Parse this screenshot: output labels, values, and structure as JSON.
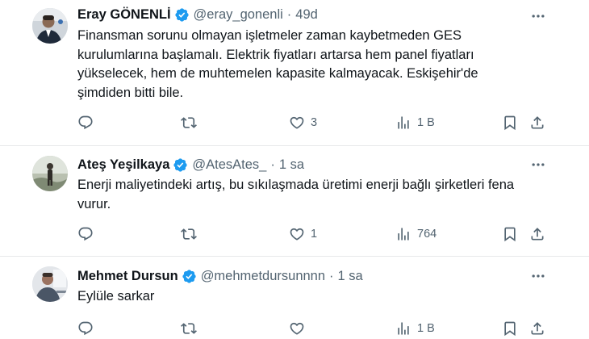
{
  "tweets": [
    {
      "name": "Eray GÖNENLİ",
      "handle": "@eray_gonenli",
      "separator": "·",
      "time": "49d",
      "text": "Finansman sorunu olmayan işletmeler zaman kaybetmeden GES\nkurulumlarına başlamalı. Elektrik fiyatları artarsa hem panel fiyatları\nyükselecek, hem de muhtemelen kapasite kalmayacak. Eskişehir'de\nşimdiden bitti bile.",
      "likes": "3",
      "views": "1 B"
    },
    {
      "name": "Ateş Yeşilkaya",
      "handle": "@AtesAtes_",
      "separator": "·",
      "time": "1 sa",
      "text": "Enerji maliyetindeki artış, bu sıkılaşmada üretimi enerji bağlı şirketleri fena\nvurur.",
      "likes": "1",
      "views": "764"
    },
    {
      "name": "Mehmet Dursun",
      "handle": "@mehmetdursunnnn",
      "separator": "·",
      "time": "1 sa",
      "text": "Eylüle sarkar",
      "likes": "",
      "views": "1 B"
    }
  ],
  "icons": {
    "verified": "verified-badge-icon",
    "more": "more-icon",
    "reply": "reply-icon",
    "retweet": "retweet-icon",
    "like": "heart-icon",
    "views": "views-icon",
    "bookmark": "bookmark-icon",
    "share": "share-icon"
  },
  "colors": {
    "verified": "#1d9bf0",
    "muted": "#536471",
    "text": "#0f1419",
    "divider": "#e7e9ea"
  }
}
